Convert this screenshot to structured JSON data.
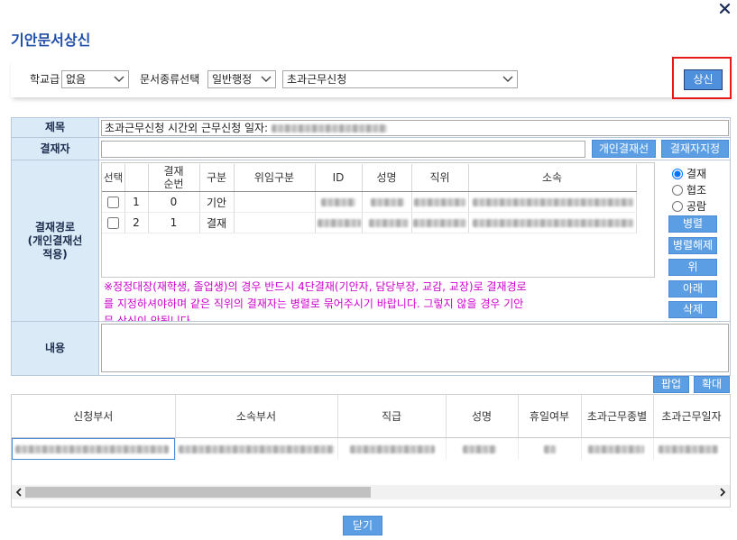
{
  "colors": {
    "title": "#1f4fa8",
    "label_bg": "#dbeaf7",
    "button_bg": "#5b9ee3",
    "notice": "#cc00cc",
    "highlight": "#e8191a"
  },
  "icons": {
    "close": "close-icon",
    "select_arrow": "chevron-down-icon",
    "scroll_left": "chevron-left-icon",
    "scroll_right": "chevron-right-icon"
  },
  "dialog": {
    "title": "기안문서상신"
  },
  "toolbar": {
    "school_level_label": "학교급",
    "school_level_value": "없음",
    "doc_type_label": "문서종류선택",
    "doc_type_value": "일반행정",
    "doc_form_value": "초과근무신청",
    "submit_label": "상신"
  },
  "form": {
    "subject": {
      "label": "제목",
      "value": "초과근무신청 시간외 근무신청 일자:"
    },
    "approver": {
      "label": "결재자",
      "personal_line_label": "개인결재선",
      "assign_label": "결재자지정"
    },
    "approval_path": {
      "label": "결재경로\n(개인결재선\n적용)",
      "headers": [
        "선택",
        "결재\n순번",
        "구분",
        "위임구분",
        "ID",
        "성명",
        "직위",
        "소속"
      ],
      "rows": [
        {
          "checked": false,
          "no": "1",
          "seq": "0",
          "type": "기안"
        },
        {
          "checked": false,
          "no": "2",
          "seq": "1",
          "type": "결재"
        }
      ],
      "approval_types": [
        {
          "label": "결재",
          "checked": true
        },
        {
          "label": "협조",
          "checked": false
        },
        {
          "label": "공람",
          "checked": false
        }
      ],
      "buttons": [
        "병렬",
        "병렬해제",
        "위",
        "아래",
        "삭제"
      ],
      "notice": "※정정대장(재학생, 졸업생)의 경우 반드시 4단결재(기안자, 담당부장, 교감, 교장)로 결재경로를 지정하셔야하며 같은 직위의 결재자는 병렬로 묶어주시기 바랍니다. 그렇지 않을 경우 기안문 상신이 안됩니다"
    },
    "content": {
      "label": "내용"
    }
  },
  "editor_buttons": {
    "popup_label": "팝업",
    "expand_label": "확대"
  },
  "grid": {
    "headers": [
      "신청부서",
      "소속부서",
      "직급",
      "성명",
      "휴일여부",
      "초과근무종별",
      "초과근무일자"
    ]
  },
  "footer": {
    "close_label": "닫기"
  }
}
